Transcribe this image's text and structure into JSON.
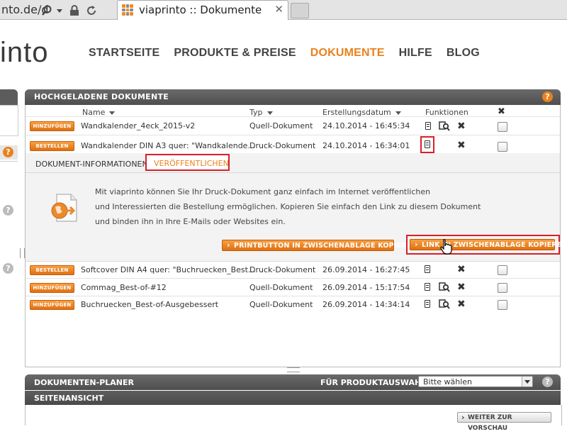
{
  "browser": {
    "url_fragment": "nto.de/d",
    "tab_title": "viaprinto :: Dokumente",
    "tab_close": "✕"
  },
  "site": {
    "logo_text": "into",
    "nav": [
      "STARTSEITE",
      "PRODUKTE & PREISE",
      "DOKUMENTE",
      "HILFE",
      "BLOG"
    ],
    "active_nav": "DOKUMENTE"
  },
  "uploaded": {
    "title": "HOCHGELADENE DOKUMENTE",
    "columns": {
      "name": "Name",
      "type": "Typ",
      "date": "Erstellungsdatum",
      "functions": "Funktionen",
      "delete": "✖"
    },
    "rows": [
      {
        "action": "HINZUFÜGEN",
        "name": "Wandkalender_4eck_2015-v2",
        "type": "Quell-Dokument",
        "date": "24.10.2014 - 16:45:34"
      },
      {
        "action": "BESTELLEN",
        "name": "Wandkalender DIN A3 quer: \"Wandkalende...",
        "type": "Druck-Dokument",
        "date": "24.10.2014 - 16:34:01"
      },
      {
        "action": "BESTELLEN",
        "name": "Softcover DIN A4 quer: \"Buchruecken_Best...",
        "type": "Druck-Dokument",
        "date": "26.09.2014 - 16:27:45"
      },
      {
        "action": "HINZUFÜGEN",
        "name": "Commag_Best-of-#12",
        "type": "Quell-Dokument",
        "date": "26.09.2014 - 15:17:54"
      },
      {
        "action": "HINZUFÜGEN",
        "name": "Buchruecken_Best-of-Ausgebessert",
        "type": "Quell-Dokument",
        "date": "26.09.2014 - 14:34:14"
      }
    ],
    "detail": {
      "tab_info": "DOKUMENT-INFORMATIONEN",
      "tab_publish": "VERÖFFENTLICHEN",
      "text1": "Mit viaprinto können Sie Ihr Druck-Dokument ganz einfach im Internet veröffentlichen",
      "text2": "und Interessierten die Bestellung ermöglichen. Kopieren Sie einfach den Link zu diesem Dokument",
      "text3": "und binden ihn in Ihre E-Mails oder Websites ein.",
      "btn_print": "PRINTBUTTON IN ZWISCHENABLAGE KOPIEREN",
      "btn_link": "LINK IN ZWISCHENABLAGE KOPIEREN"
    }
  },
  "planner": {
    "title": "DOKUMENTEN-PLANER",
    "product_label": "FÜR PRODUKTAUSWAHL:",
    "select_value": "Bitte wählen"
  },
  "pageview": {
    "title": "SEITENANSICHT",
    "preview_button": "WEITER ZUR VORSCHAU"
  },
  "help_glyph": "?",
  "colors": {
    "accent": "#e8821e",
    "highlight": "#d8202a",
    "header": "#555555"
  }
}
